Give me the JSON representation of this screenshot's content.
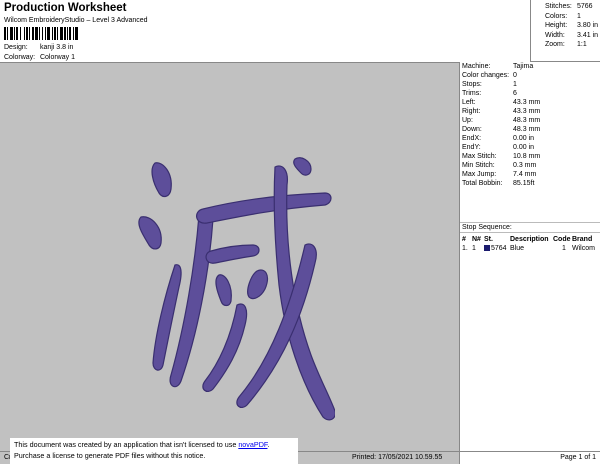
{
  "header": {
    "title": "Production Worksheet",
    "subtitle": "Wilcom EmbroideryStudio – Level 3 Advanced",
    "design_label": "Design:",
    "design_value": "kanji 3.8 in",
    "colorway_label": "Colorway:",
    "colorway_value": "Colorway 1"
  },
  "stats": [
    {
      "label": "Stitches:",
      "value": "5766"
    },
    {
      "label": "Colors:",
      "value": "1"
    },
    {
      "label": "Height:",
      "value": "3.80 in"
    },
    {
      "label": "Width:",
      "value": "3.41 in"
    },
    {
      "label": "Zoom:",
      "value": "1:1"
    }
  ],
  "machine_info": [
    {
      "label": "Machine:",
      "value": "Tajima"
    },
    {
      "label": "Color changes:",
      "value": "0"
    },
    {
      "label": "Stops:",
      "value": "1"
    },
    {
      "label": "Trims:",
      "value": "6"
    },
    {
      "label": "Left:",
      "value": "43.3 mm"
    },
    {
      "label": "Right:",
      "value": "43.3 mm"
    },
    {
      "label": "Up:",
      "value": "48.3 mm"
    },
    {
      "label": "Down:",
      "value": "48.3 mm"
    },
    {
      "label": "EndX:",
      "value": "0.00 in"
    },
    {
      "label": "EndY:",
      "value": "0.00 in"
    },
    {
      "label": "Max Stitch:",
      "value": "10.8 mm"
    },
    {
      "label": "Min Stitch:",
      "value": "0.3 mm"
    },
    {
      "label": "Max Jump:",
      "value": "7.4 mm"
    },
    {
      "label": "Total Bobbin:",
      "value": "85.15ft"
    }
  ],
  "stop_sequence": {
    "title": "Stop Sequence:",
    "columns": [
      "#",
      "N#",
      "St.",
      "Description",
      "Code",
      "Brand"
    ],
    "rows": [
      {
        "num": "1.",
        "n": "1",
        "st": "5764",
        "description": "Blue",
        "code": "1",
        "brand": "Wilcom"
      }
    ]
  },
  "colors": {
    "canvas_bg": "#c1c1c1",
    "thread": "#5d4e9a",
    "swatch": "#1b1b6e"
  },
  "footer": {
    "left": "Cr",
    "printed": "Printed: 17/05/2021 10.59.55",
    "page": "Page 1 of 1"
  },
  "notice": {
    "line1_prefix": "This document was created by an application that isn't licensed to use ",
    "link": "novaPDF",
    "line1_suffix": ".",
    "line2": "Purchase a license to generate PDF files without this notice."
  }
}
